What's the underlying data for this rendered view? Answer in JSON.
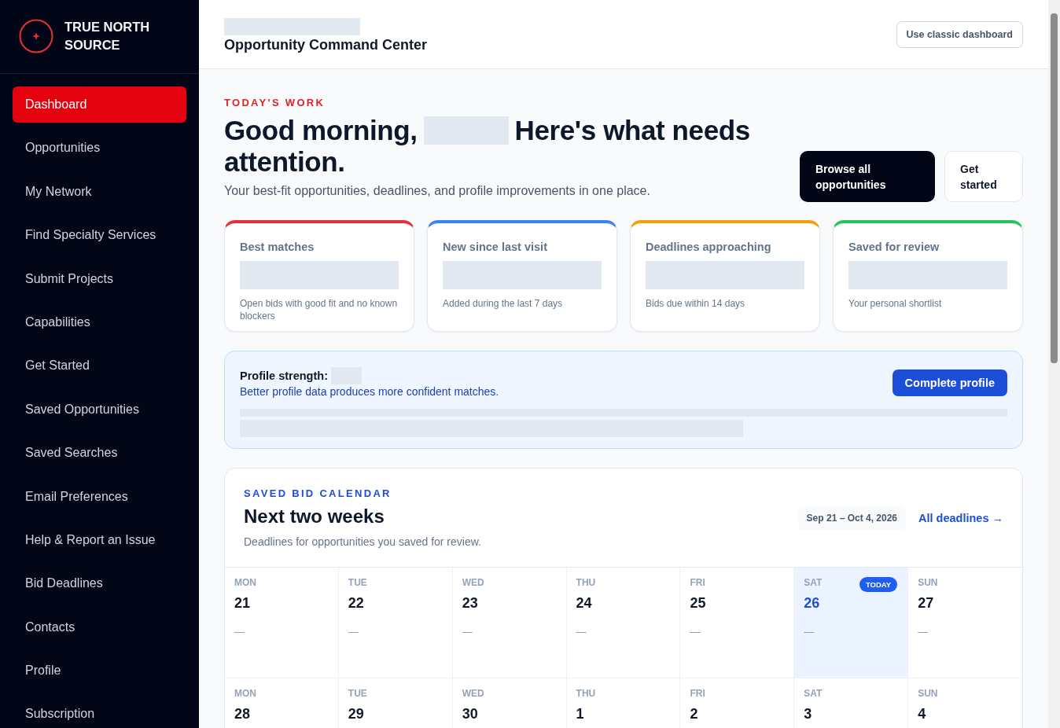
{
  "brand": {
    "name": "TRUE NORTH SOURCE"
  },
  "sidebar": {
    "items": [
      {
        "label": "Dashboard",
        "selected": true
      },
      {
        "label": "Opportunities",
        "selected": false
      },
      {
        "label": "My Network",
        "selected": false
      },
      {
        "label": "Find Specialty Services",
        "selected": false
      },
      {
        "label": "Submit Projects",
        "selected": false
      },
      {
        "label": "Capabilities",
        "selected": false
      },
      {
        "label": "Get Started",
        "selected": false
      },
      {
        "label": "Saved Opportunities",
        "selected": false
      },
      {
        "label": "Saved Searches",
        "selected": false
      },
      {
        "label": "Email Preferences",
        "selected": false
      },
      {
        "label": "Help & Report an Issue",
        "selected": false
      },
      {
        "label": "Bid Deadlines",
        "selected": false
      },
      {
        "label": "Contacts",
        "selected": false
      },
      {
        "label": "Profile",
        "selected": false
      },
      {
        "label": "Subscription",
        "selected": false
      }
    ]
  },
  "header": {
    "title": "Opportunity Command Center",
    "action": "Use classic dashboard"
  },
  "hero": {
    "eyebrow": "TODAY'S WORK",
    "greeting": "Good morning,",
    "headline": [
      "Here's what needs",
      "attention."
    ],
    "subtitle": "Your best-fit opportunities, deadlines, and profile improvements in one place.",
    "primary_button": "Browse all opportunities",
    "secondary_button": "Get started"
  },
  "stat_cards": [
    {
      "title": "Best matches",
      "caption": "Open bids with good fit and no known blockers",
      "color": "#e5303a"
    },
    {
      "title": "New since last visit",
      "caption": "Added during the last 7 days",
      "color": "#3b82f6"
    },
    {
      "title": "Deadlines approaching",
      "caption": "Bids due within 14 days",
      "color": "#f59e0b"
    },
    {
      "title": "Saved for review",
      "caption": "Your personal shortlist",
      "color": "#22c55e"
    }
  ],
  "profile": {
    "label": "Profile strength:",
    "note": "Better profile data produces more confident matches.",
    "button": "Complete profile"
  },
  "calendar": {
    "eyebrow": "SAVED BID CALENDAR",
    "title": "Next two weeks",
    "subtitle": "Deadlines for opportunities you saved for review.",
    "range": "Sep 21 – Oct 4, 2026",
    "link": "All deadlines →",
    "today_badge": "TODAY",
    "days": [
      {
        "dow": "MON",
        "date": "21",
        "entry": "—",
        "today": false
      },
      {
        "dow": "TUE",
        "date": "22",
        "entry": "—",
        "today": false
      },
      {
        "dow": "WED",
        "date": "23",
        "entry": "—",
        "today": false
      },
      {
        "dow": "THU",
        "date": "24",
        "entry": "—",
        "today": false
      },
      {
        "dow": "FRI",
        "date": "25",
        "entry": "—",
        "today": false
      },
      {
        "dow": "SAT",
        "date": "26",
        "entry": "—",
        "today": true
      },
      {
        "dow": "SUN",
        "date": "27",
        "entry": "—",
        "today": false
      },
      {
        "dow": "MON",
        "date": "28",
        "today": false
      },
      {
        "dow": "TUE",
        "date": "29",
        "today": false
      },
      {
        "dow": "WED",
        "date": "30",
        "today": false
      },
      {
        "dow": "THU",
        "date": "1",
        "today": false
      },
      {
        "dow": "FRI",
        "date": "2",
        "today": false
      },
      {
        "dow": "SAT",
        "date": "3",
        "today": false
      },
      {
        "dow": "SUN",
        "date": "4",
        "today": false
      }
    ]
  }
}
